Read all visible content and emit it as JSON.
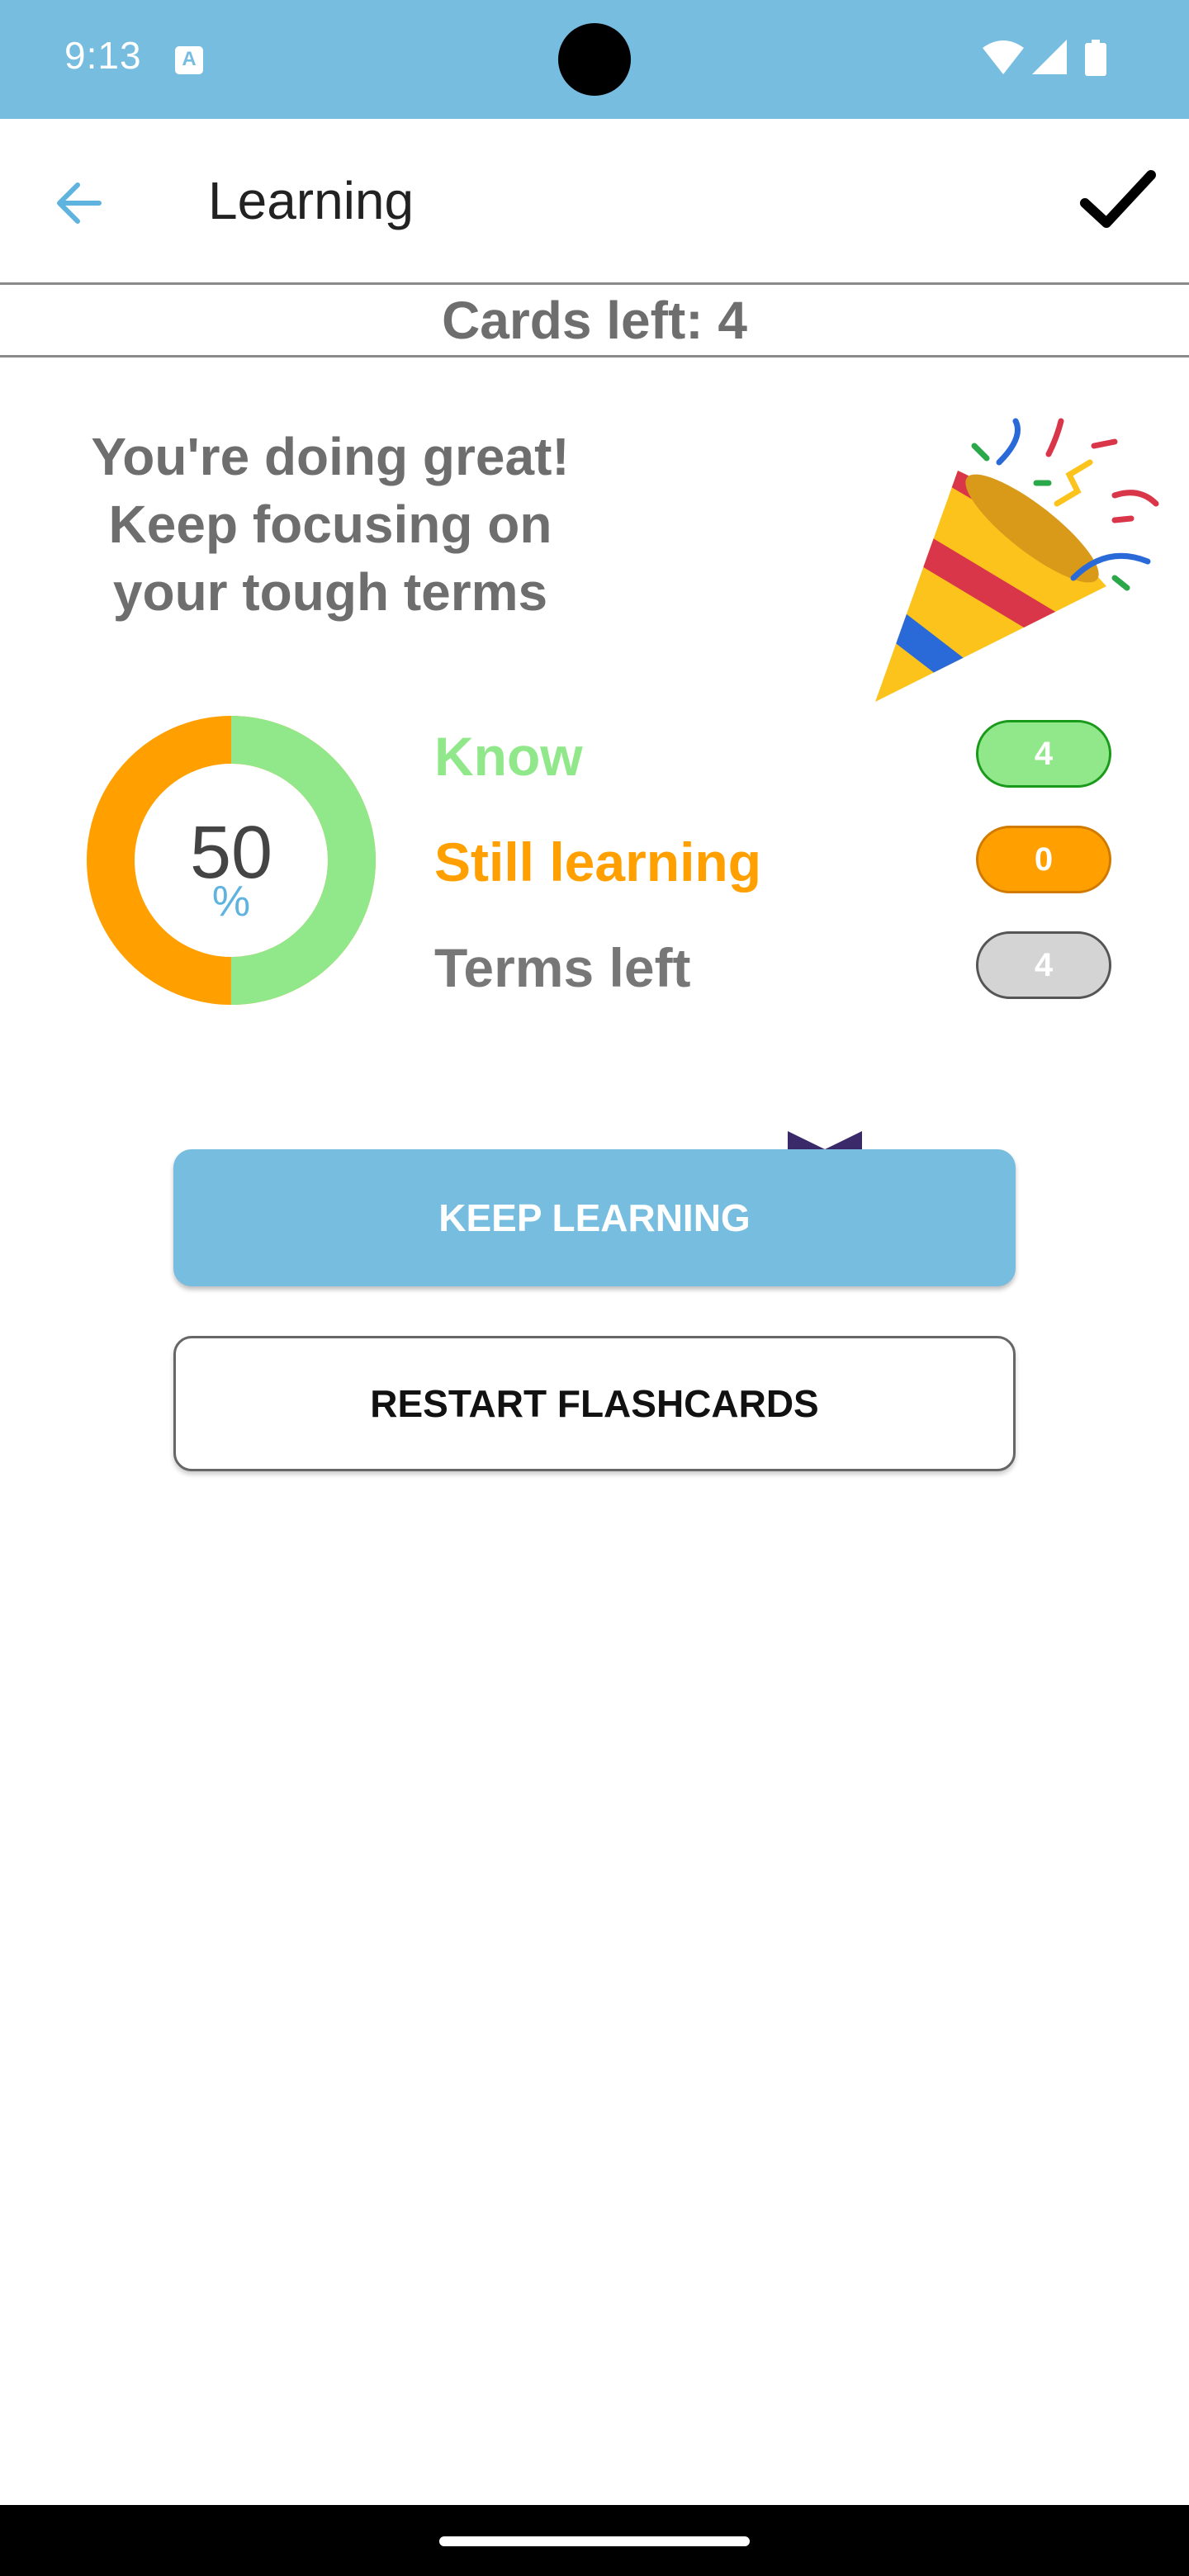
{
  "status_bar": {
    "time": "9:13",
    "notification_icon": "text-a-icon",
    "icons": [
      "wifi-icon",
      "cellular-signal-icon",
      "battery-icon"
    ],
    "background_color": "#76bde0"
  },
  "app_bar": {
    "back_icon": "arrow-left-icon",
    "title": "Learning",
    "done_icon": "check-icon"
  },
  "progress": {
    "cards_left": "Cards left: 4"
  },
  "message": {
    "lines": [
      "You're doing great!",
      "Keep focusing on",
      "your tough terms"
    ],
    "illustration": "party-popper-icon"
  },
  "donut": {
    "value": "50",
    "unit": "%",
    "know_fraction": 0.5,
    "colors": {
      "know": "#90e88a",
      "still_learning": "#ffa000"
    }
  },
  "stats": [
    {
      "label": "Know",
      "count": "4",
      "color": "#90e88a"
    },
    {
      "label": "Still learning",
      "count": "0",
      "color": "#ffa000"
    },
    {
      "label": "Terms left",
      "count": "4",
      "color": "#777777"
    }
  ],
  "actions": {
    "keep_learning": "KEEP LEARNING",
    "restart": "RESTART FLASHCARDS"
  }
}
